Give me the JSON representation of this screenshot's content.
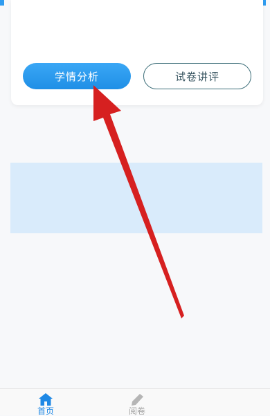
{
  "card": {
    "primary_button": "学情分析",
    "secondary_button": "试卷讲评"
  },
  "tabbar": {
    "home": {
      "label": "首页",
      "icon": "home-icon"
    },
    "review": {
      "label": "阅卷",
      "icon": "pencil-icon"
    }
  },
  "colors": {
    "accent": "#2f9cf0",
    "banner": "#d9ebfb",
    "arrow": "#d62020",
    "tab_active": "#1e88e5",
    "tab_inactive": "#a5a5a5"
  }
}
